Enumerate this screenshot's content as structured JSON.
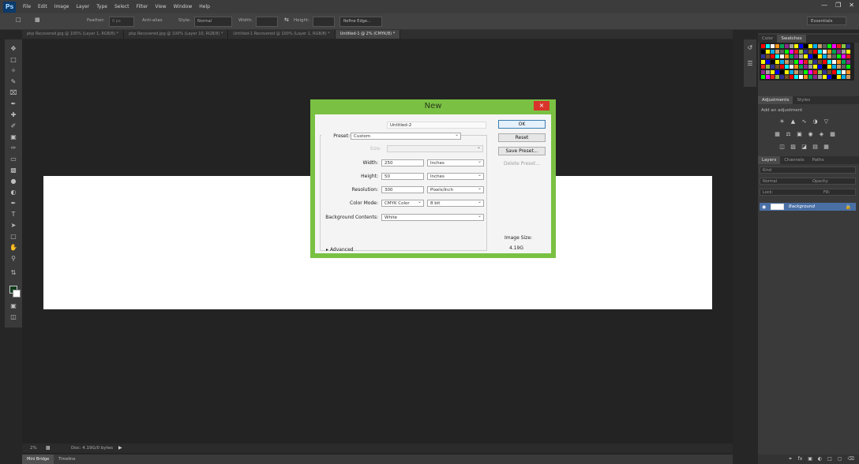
{
  "app": {
    "logo": "Ps",
    "menu": [
      "File",
      "Edit",
      "Image",
      "Layer",
      "Type",
      "Select",
      "Filter",
      "View",
      "Window",
      "Help"
    ],
    "workspace": "Essentials"
  },
  "options_bar": {
    "feather_label": "Feather:",
    "feather_value": "0 px",
    "antialias_label": "Anti-alias",
    "style_label": "Style:",
    "style_value": "Normal",
    "width_label": "Width:",
    "height_label": "Height:",
    "refine_edge": "Refine Edge..."
  },
  "tabs": [
    {
      "label": "pkp Recovered.jpg @ 100% (Layer 1, RGB/8) *",
      "active": false
    },
    {
      "label": "pkp Recovered.jpg @ 100% (Layer 10, RGB/8) *",
      "active": false
    },
    {
      "label": "Untitled-1 Recovered @ 100% (Layer 1, RGB/8) *",
      "active": false
    },
    {
      "label": "Untitled-1 @ 2% (CMYK/8) *",
      "active": true
    }
  ],
  "status": {
    "zoom": "2%",
    "doc": "Doc: 4.19G/0 bytes"
  },
  "bottom_tabs": [
    {
      "label": "Mini Bridge",
      "active": true
    },
    {
      "label": "Timeline",
      "active": false
    }
  ],
  "panels": {
    "color_tabs": [
      {
        "label": "Color",
        "active": false
      },
      {
        "label": "Swatches",
        "active": true
      }
    ],
    "adjust_tabs": [
      {
        "label": "Adjustments",
        "active": true
      },
      {
        "label": "Styles",
        "active": false
      }
    ],
    "adjust_hint": "Add an adjustment",
    "layer_tabs": [
      {
        "label": "Layers",
        "active": true
      },
      {
        "label": "Channels",
        "active": false
      },
      {
        "label": "Paths",
        "active": false
      }
    ],
    "kind_label": "Kind",
    "blend_mode": "Normal",
    "opacity_label": "Opacity:",
    "lock_label": "Lock:",
    "fill_label": "Fill:",
    "layer_name": "Background"
  },
  "dialog": {
    "title": "New",
    "close": "×",
    "name_label": "Name:",
    "name_value": "Untitled-2",
    "preset_label": "Preset:",
    "preset_value": "Custom",
    "size_label": "Size:",
    "width_label": "Width:",
    "width_value": "250",
    "width_unit": "Inches",
    "height_label": "Height:",
    "height_value": "50",
    "height_unit": "Inches",
    "resolution_label": "Resolution:",
    "resolution_value": "300",
    "resolution_unit": "Pixels/Inch",
    "color_mode_label": "Color Mode:",
    "color_mode_value": "CMYK Color",
    "bit_depth": "8 bit",
    "bg_contents_label": "Background Contents:",
    "bg_contents_value": "White",
    "advanced_label": "Advanced",
    "ok": "OK",
    "reset": "Reset",
    "save_preset": "Save Preset...",
    "delete_preset": "Delete Preset...",
    "image_size_label": "Image Size:",
    "image_size_value": "4.19G"
  },
  "colors": {
    "dialog_frame": "#7ac143",
    "close_button": "#d9342b",
    "selected_layer": "#4a6fa5"
  }
}
